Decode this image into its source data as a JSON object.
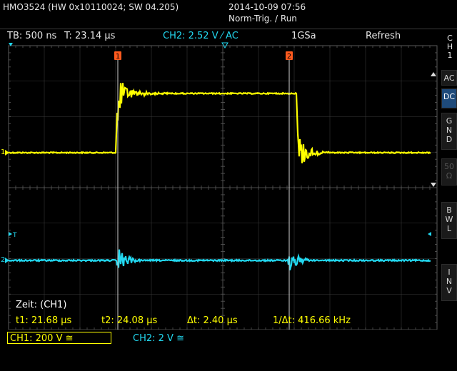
{
  "header": {
    "model": "HMO3524 (HW 0x10110024; SW 04.205)",
    "datetime": "2014-10-09 07:56",
    "trigger_mode": "Norm-Trig. / Run"
  },
  "topbar": {
    "timebase": "TB: 500 ns",
    "trigger_time": "T: 23.14 µs",
    "trigger_source": "CH2: 2.52 V ⁄ AC",
    "sample_rate": "1GSa",
    "acquire_mode": "Refresh"
  },
  "side_panel": {
    "channel_label": "C\nH\n1",
    "buttons": [
      {
        "label": "AC",
        "active": false,
        "dim": false
      },
      {
        "label": "DC",
        "active": true,
        "dim": false
      },
      {
        "label": "G\nN\nD",
        "active": false,
        "dim": false
      },
      {
        "label": "50\nΩ",
        "active": false,
        "dim": true
      },
      {
        "label": "B\nW\nL",
        "active": false,
        "dim": false
      },
      {
        "label": "I\nN\nV",
        "active": false,
        "dim": false
      }
    ]
  },
  "markers": {
    "cursor1": "1",
    "cursor2": "2",
    "ch1_level": "1",
    "ch2_level": "2",
    "trigger": "T"
  },
  "measurements": {
    "title": "Zeit: (CH1)",
    "t1": "t1: 21.68 µs",
    "t2": "t2: 24.08 µs",
    "dt": "Δt: 2.40 µs",
    "inv_dt": "1/Δt: 416.66 kHz"
  },
  "channels": {
    "ch1": "CH1: 200 V ≅",
    "ch2": "CH2: 2 V ≅"
  },
  "colors": {
    "ch1": "#ffff00",
    "ch2": "#22d8f0",
    "grid": "#5a5a5a",
    "cursor": "#cfcfcf",
    "marker": "#ff5a1e"
  }
}
